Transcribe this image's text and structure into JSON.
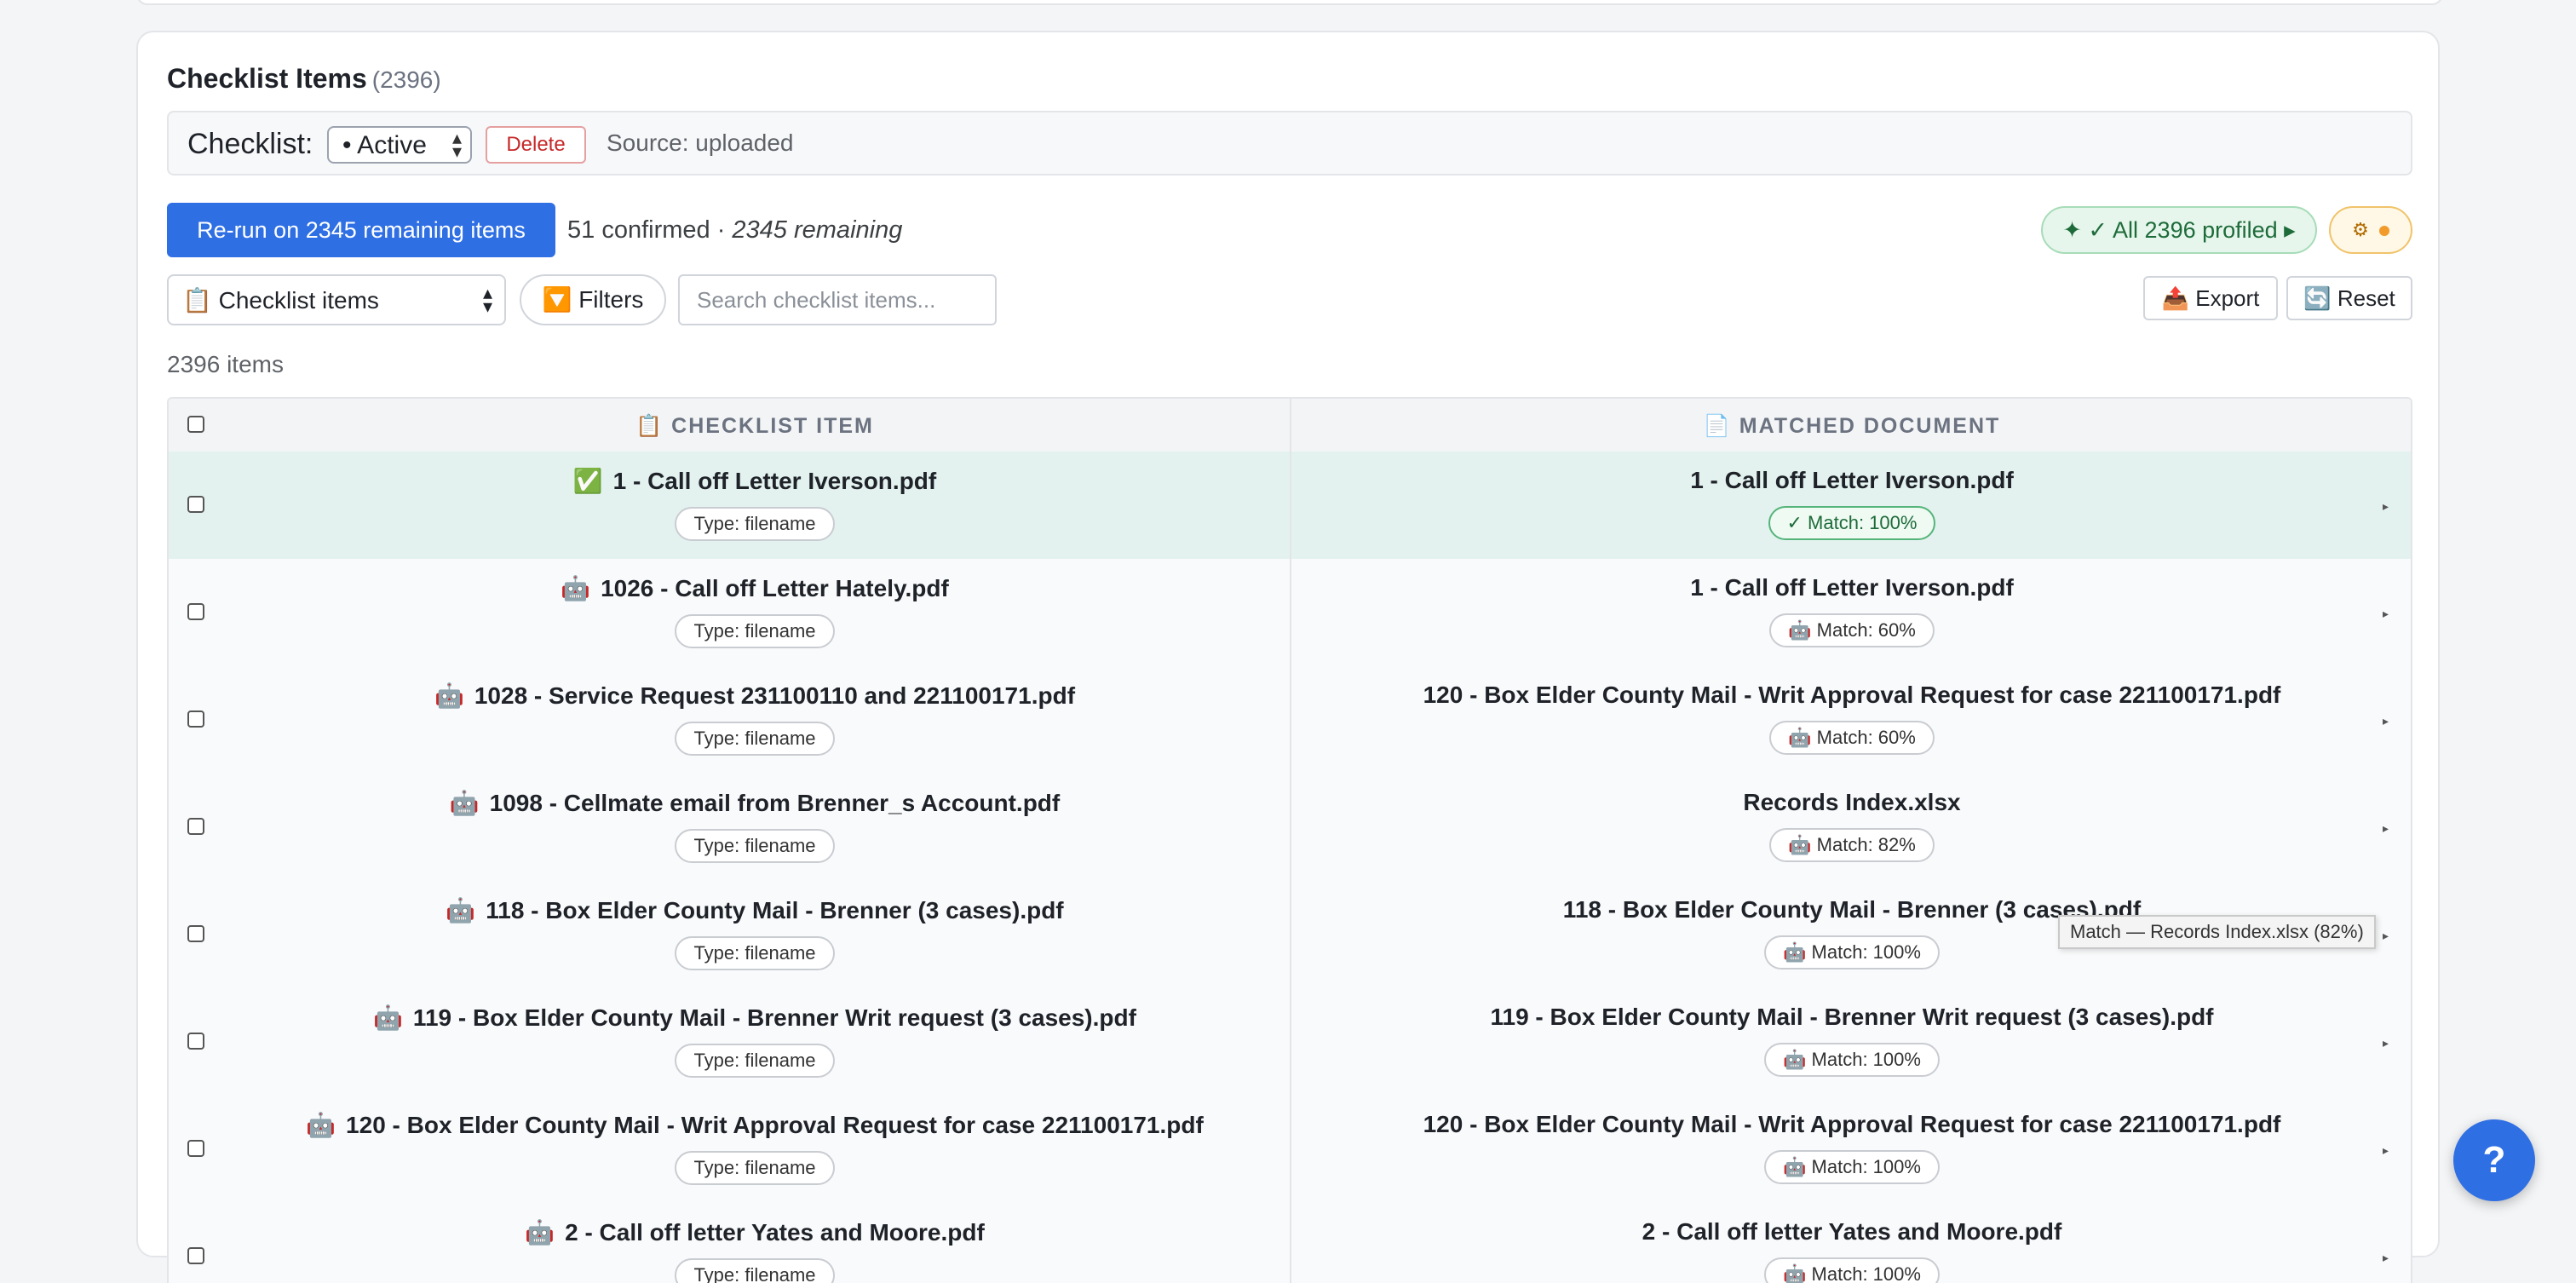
{
  "header": {
    "title": "Checklist Items",
    "count": "(2396)"
  },
  "checklist_bar": {
    "label": "Checklist:",
    "selected": "• Active",
    "delete_label": "Delete",
    "source": "Source: uploaded"
  },
  "actions": {
    "rerun_label": "Re-run on 2345 remaining items",
    "confirmed_text": "51 confirmed · ",
    "remaining_text": "2345 remaining",
    "profiled_label": "✦ ✓ All 2396 profiled ▸",
    "settings_icon": "⚙"
  },
  "toolbar": {
    "view_select": "📋 Checklist items",
    "filters_label": "🔽 Filters",
    "search_placeholder": "Search checklist items...",
    "export_label": "📤 Export",
    "reset_label": "🔄 Reset"
  },
  "items_count": "2396 items",
  "table": {
    "col_item": "📋 CHECKLIST ITEM",
    "col_doc": "📄 MATCHED DOCUMENT",
    "rows": [
      {
        "icon": "✅",
        "item": "1 - Call off Letter Iverson.pdf",
        "type": "Type: filename",
        "doc": "1 - Call off Letter Iverson.pdf",
        "match": "✓ Match: 100%",
        "status": "confirmed"
      },
      {
        "icon": "🤖",
        "item": "1026 - Call off Letter Hately.pdf",
        "type": "Type: filename",
        "doc": "1 - Call off Letter Iverson.pdf",
        "match": "🤖 Match: 60%",
        "status": "auto"
      },
      {
        "icon": "🤖",
        "item": "1028 - Service Request 231100110 and 221100171.pdf",
        "type": "Type: filename",
        "doc": "120 - Box Elder County Mail - Writ Approval Request for case 221100171.pdf",
        "match": "🤖 Match: 60%",
        "status": "auto"
      },
      {
        "icon": "🤖",
        "item": "1098 - Cellmate email from Brenner_s Account.pdf",
        "type": "Type: filename",
        "doc": "Records Index.xlsx",
        "match": "🤖 Match: 82%",
        "status": "auto"
      },
      {
        "icon": "🤖",
        "item": "118 - Box Elder County Mail - Brenner (3 cases).pdf",
        "type": "Type: filename",
        "doc": "118 - Box Elder County Mail - Brenner (3 cases).pdf",
        "match": "🤖 Match: 100%",
        "status": "auto"
      },
      {
        "icon": "🤖",
        "item": "119 - Box Elder County Mail - Brenner Writ request (3 cases).pdf",
        "type": "Type: filename",
        "doc": "119 - Box Elder County Mail - Brenner Writ request (3 cases).pdf",
        "match": "🤖 Match: 100%",
        "status": "auto"
      },
      {
        "icon": "🤖",
        "item": "120 - Box Elder County Mail - Writ Approval Request for case 221100171.pdf",
        "type": "Type: filename",
        "doc": "120 - Box Elder County Mail - Writ Approval Request for case 221100171.pdf",
        "match": "🤖 Match: 100%",
        "status": "auto"
      },
      {
        "icon": "🤖",
        "item": "2 - Call off letter Yates and Moore.pdf",
        "type": "Type: filename",
        "doc": "2 - Call off letter Yates and Moore.pdf",
        "match": "🤖 Match: 100%",
        "status": "auto"
      }
    ]
  },
  "tooltip": "Match — Records Index.xlsx (82%)",
  "help_label": "?",
  "colors": {
    "accent": "#2f6fe4",
    "confirmed_row": "#e3f2ef",
    "danger": "#c62828",
    "success": "#1e6b3a"
  }
}
